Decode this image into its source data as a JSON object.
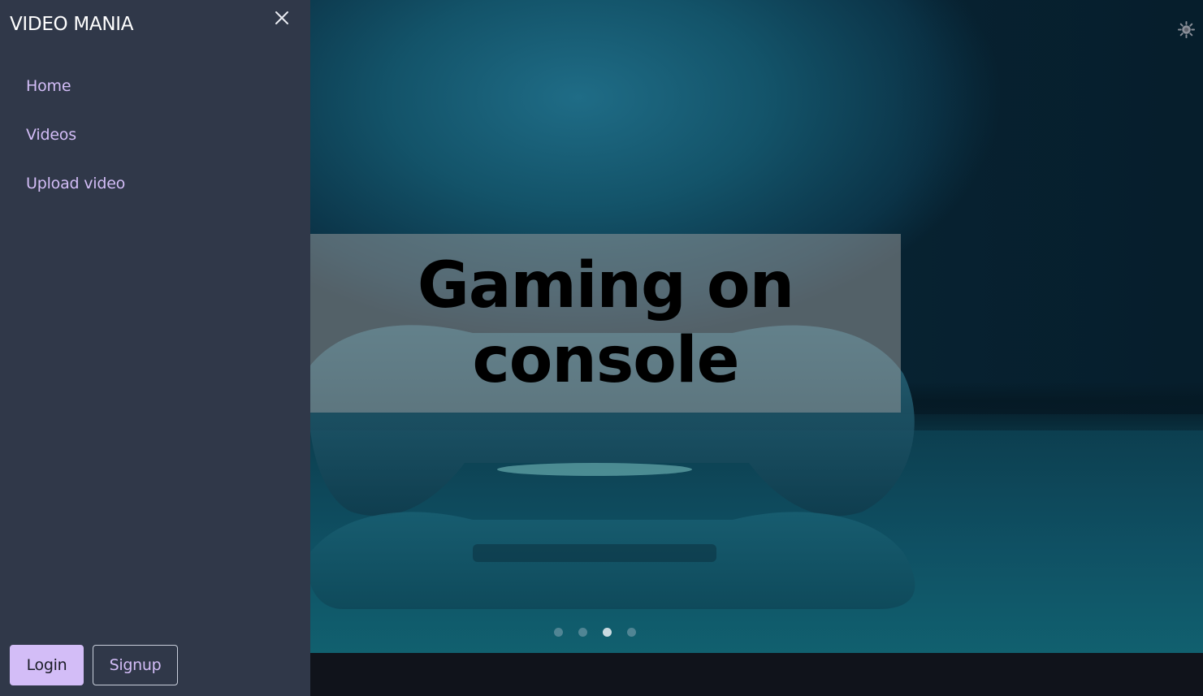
{
  "sidebar": {
    "brand": "VIDEO MANIA",
    "close_icon": "close-icon",
    "nav": [
      {
        "label": "Home"
      },
      {
        "label": "Videos"
      },
      {
        "label": "Upload video"
      }
    ],
    "login_label": "Login",
    "signup_label": "Signup"
  },
  "carousel": {
    "caption": "Gaming on console",
    "slide_count": 4,
    "active_slide": 3
  },
  "header": {
    "theme_icon": "sun-icon"
  },
  "colors": {
    "sidebar_bg": "#303849",
    "accent": "#d3bdf7",
    "page_bg": "#10131b"
  }
}
